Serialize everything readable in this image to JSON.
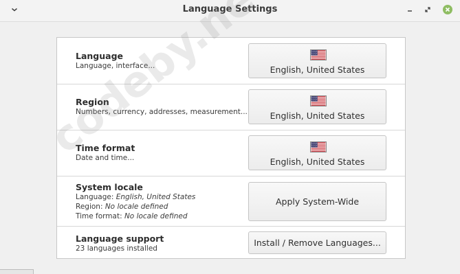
{
  "window": {
    "title": "Language Settings",
    "icons": {
      "menu": "chevron-down-icon",
      "minimize": "minimize-icon",
      "maximize": "maximize-icon",
      "close": "close-icon"
    },
    "close_color": "#8fbd63"
  },
  "rows": {
    "language": {
      "heading": "Language",
      "subtitle": "Language, interface...",
      "button_label": "English, United States",
      "flag_icon": "us-flag-icon"
    },
    "region": {
      "heading": "Region",
      "subtitle": "Numbers, currency, addresses, measurement...",
      "button_label": "English, United States",
      "flag_icon": "us-flag-icon"
    },
    "time_format": {
      "heading": "Time format",
      "subtitle": "Date and time...",
      "button_label": "English, United States",
      "flag_icon": "us-flag-icon"
    },
    "system_locale": {
      "heading": "System locale",
      "language_prefix": "Language: ",
      "language_value": "English, United States",
      "region_prefix": "Region: ",
      "region_value": "No locale defined",
      "time_prefix": "Time format: ",
      "time_value": "No locale defined",
      "button_label": "Apply System-Wide"
    },
    "language_support": {
      "heading": "Language support",
      "subtitle": "23 languages installed",
      "button_label": "Install / Remove Languages..."
    }
  },
  "watermark": "codeby.net"
}
